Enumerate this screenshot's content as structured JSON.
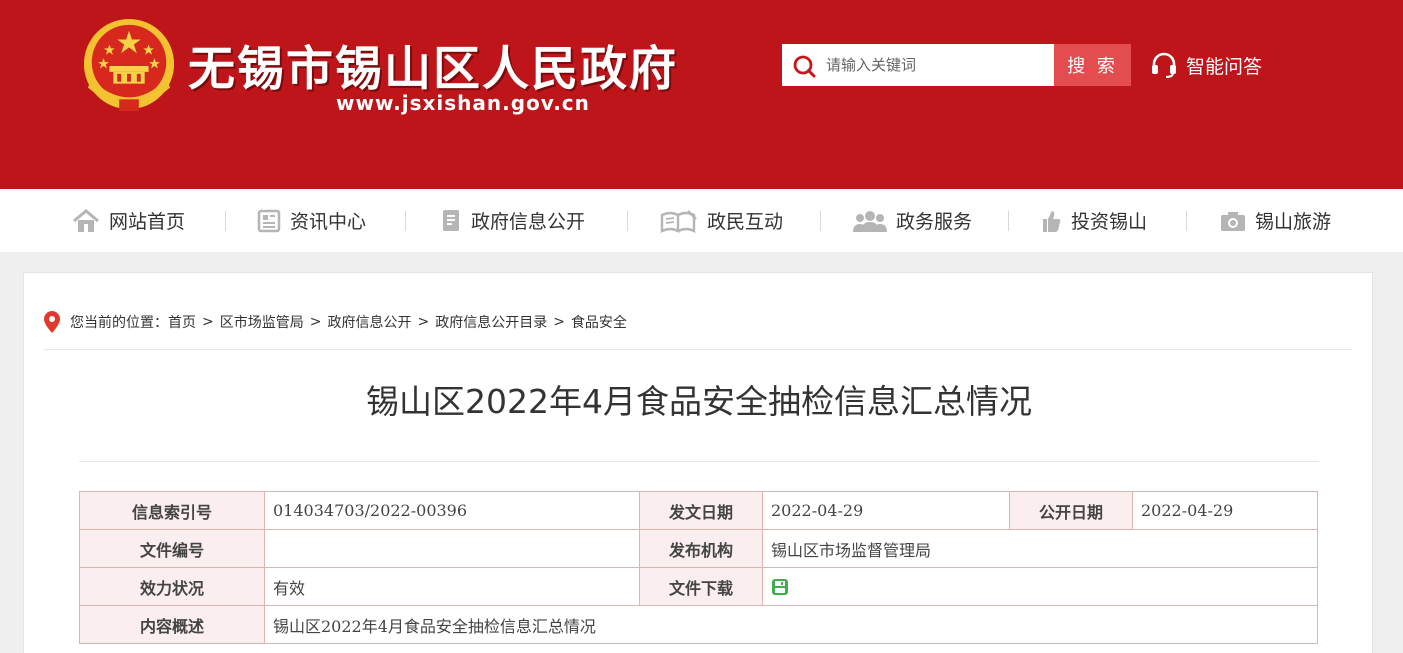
{
  "header": {
    "site_title": "无锡市锡山区人民政府",
    "site_url": "www.jsxishan.gov.cn",
    "search_placeholder": "请输入关键词",
    "search_button": "搜 索",
    "qa_label": "智能问答"
  },
  "nav": {
    "items": [
      {
        "label": "网站首页",
        "icon": "home-icon"
      },
      {
        "label": "资讯中心",
        "icon": "news-icon"
      },
      {
        "label": "政府信息公开",
        "icon": "document-icon"
      },
      {
        "label": "政民互动",
        "icon": "interaction-icon"
      },
      {
        "label": "政务服务",
        "icon": "service-icon"
      },
      {
        "label": "投资锡山",
        "icon": "investment-icon"
      },
      {
        "label": "锡山旅游",
        "icon": "camera-icon"
      }
    ]
  },
  "breadcrumb": {
    "prefix": "您当前的位置：",
    "items": [
      "首页",
      "区市场监管局",
      "政府信息公开",
      "政府信息公开目录",
      "食品安全"
    ],
    "separator": ">"
  },
  "article": {
    "title": "锡山区2022年4月食品安全抽检信息汇总情况"
  },
  "meta": {
    "index_label": "信息索引号",
    "index_value": "014034703/2022-00396",
    "issue_date_label": "发文日期",
    "issue_date_value": "2022-04-29",
    "public_date_label": "公开日期",
    "public_date_value": "2022-04-29",
    "doc_no_label": "文件编号",
    "doc_no_value": "",
    "publisher_label": "发布机构",
    "publisher_value": "锡山区市场监督管理局",
    "validity_label": "效力状况",
    "validity_value": "有效",
    "download_label": "文件下载",
    "summary_label": "内容概述",
    "summary_value": "锡山区2022年4月食品安全抽检信息汇总情况"
  },
  "colors": {
    "header_red": "#bd1519",
    "search_button": "#e34d4f",
    "meta_border": "#e0b3b3",
    "meta_label_bg": "#fbeeee",
    "download_green": "#3fae49"
  }
}
